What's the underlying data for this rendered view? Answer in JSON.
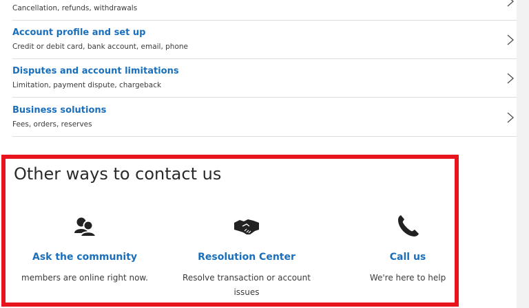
{
  "help_items": [
    {
      "title": "",
      "desc": "Cancellation, refunds, withdrawals"
    },
    {
      "title": "Account profile and set up",
      "desc": "Credit or debit card, bank account, email, phone"
    },
    {
      "title": "Disputes and account limitations",
      "desc": "Limitation, payment dispute, chargeback"
    },
    {
      "title": "Business solutions",
      "desc": "Fees, orders, reserves"
    }
  ],
  "contact": {
    "title": "Other ways to contact us",
    "options": [
      {
        "title": "Ask the community",
        "desc": "members are online right now.",
        "icon": "community-icon"
      },
      {
        "title": "Resolution Center",
        "desc": "Resolve transaction or account issues",
        "icon": "handshake-icon"
      },
      {
        "title": "Call us",
        "desc": "We're here to help",
        "icon": "phone-icon"
      }
    ]
  },
  "colors": {
    "link_blue": "#1a6fbd",
    "highlight_red": "#e8141d"
  }
}
